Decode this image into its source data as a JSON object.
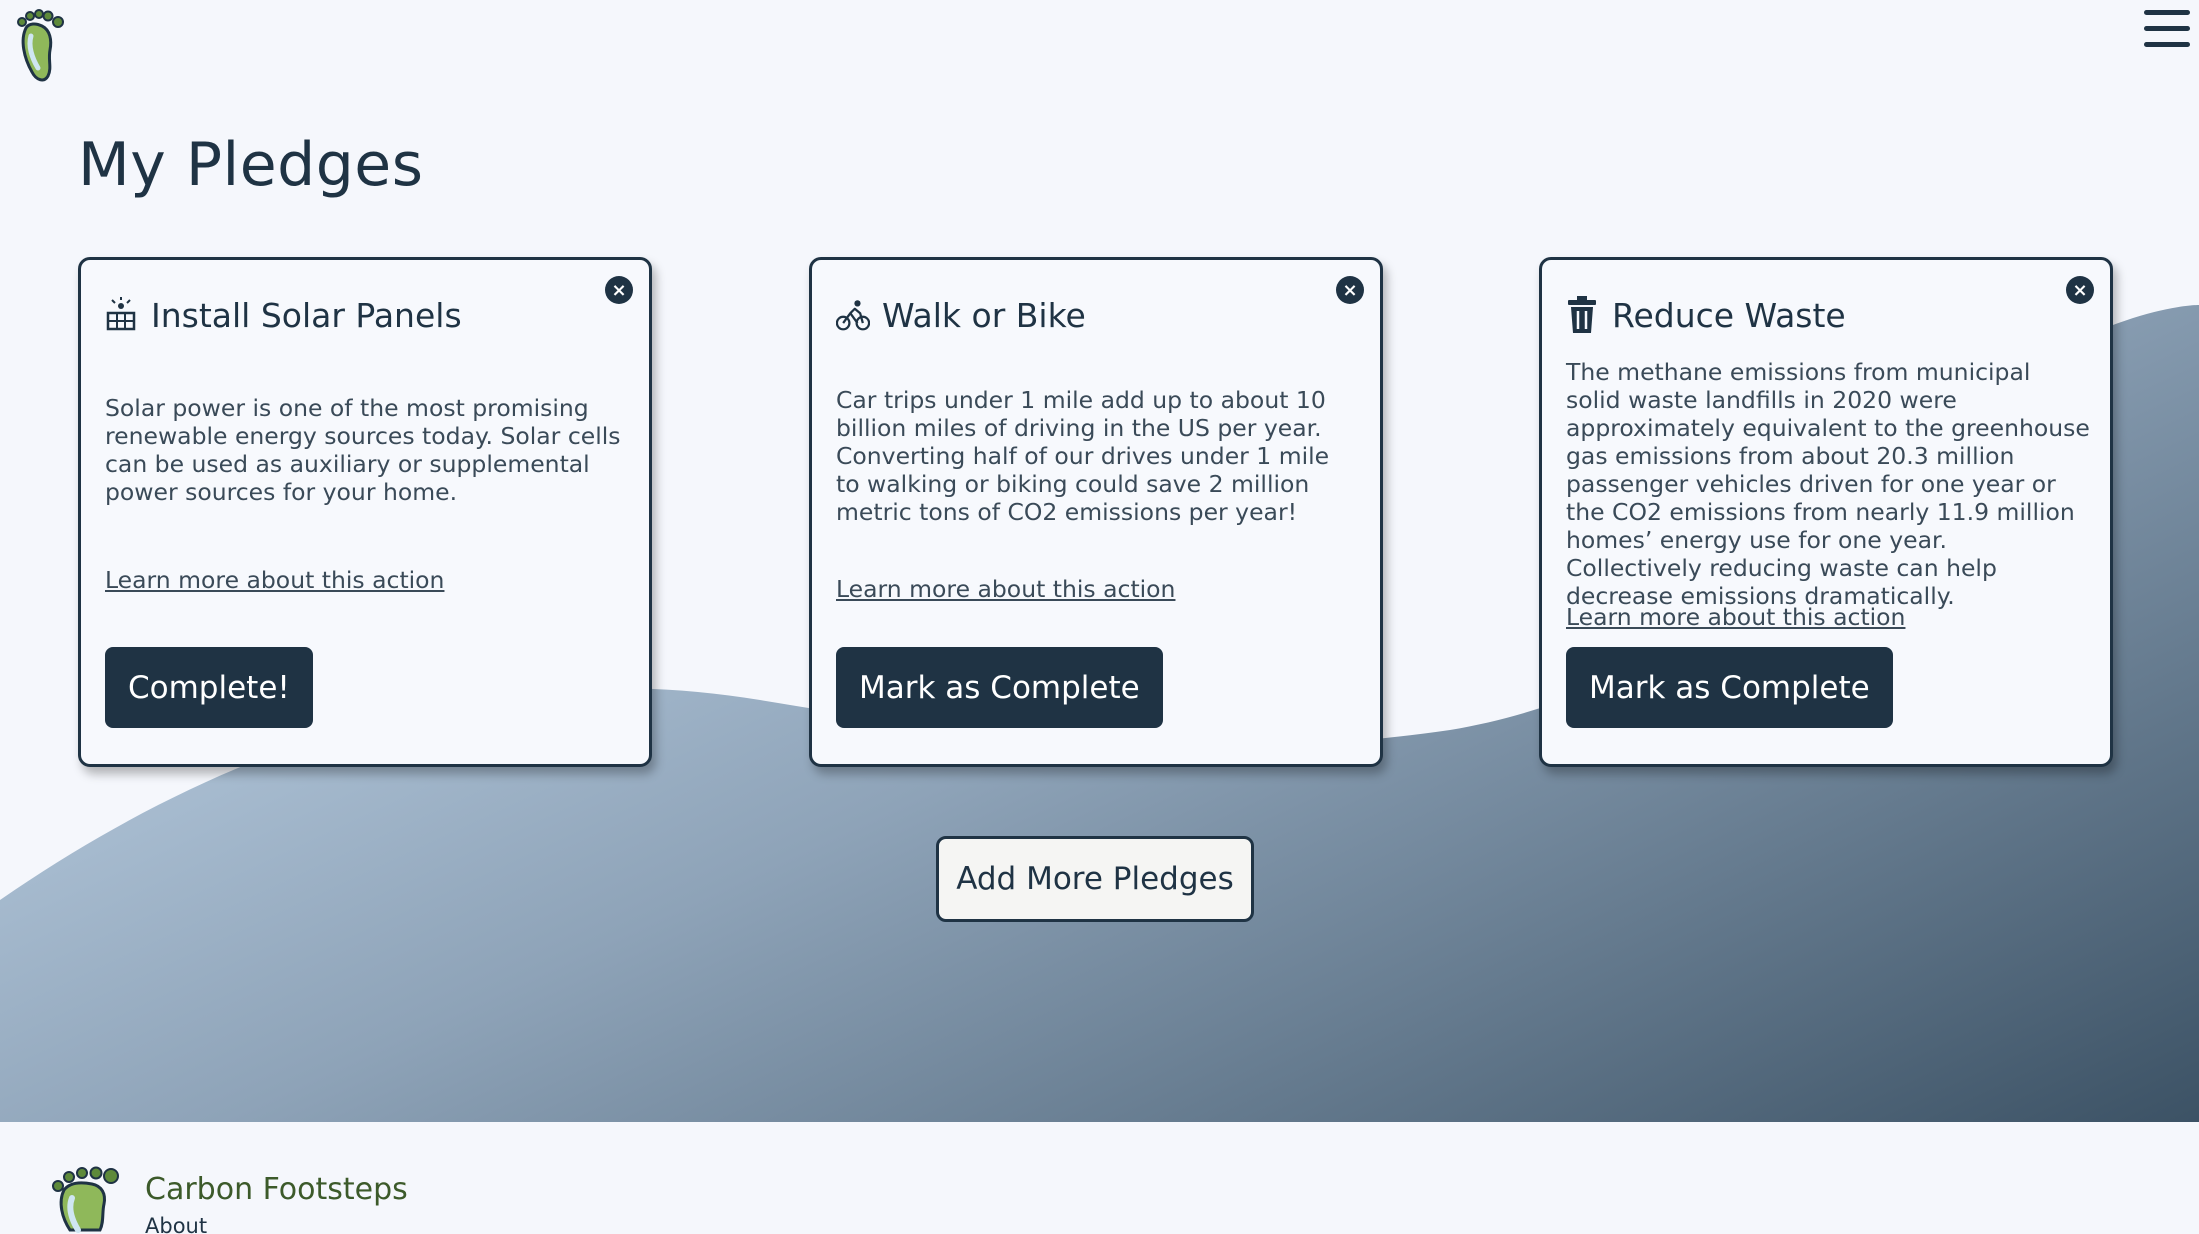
{
  "page": {
    "title": "My Pledges"
  },
  "header": {
    "logo_icon": "footprint-logo-icon",
    "menu_icon": "hamburger-menu-icon"
  },
  "pledges": [
    {
      "icon": "solar-panel-icon",
      "title": "Install Solar Panels",
      "description": "Solar power is one of the most promising renewable energy sources today. Solar cells can be used as auxiliary or supplemental power sources for your home.",
      "link": "Learn more about this action",
      "button": "Complete!",
      "close_icon": "close-icon"
    },
    {
      "icon": "bicycle-icon",
      "title": "Walk or Bike",
      "description": "Car trips under 1 mile add up to about 10 billion miles of driving in the US per year. Converting half of our drives under 1 mile to walking or biking could save 2 million metric tons of CO2 emissions per year!",
      "link": "Learn more about this action",
      "button": "Mark as Complete",
      "close_icon": "close-icon"
    },
    {
      "icon": "trash-icon",
      "title": "Reduce Waste",
      "description": "The methane emissions from municipal solid waste landfills in 2020 were approximately equivalent to the greenhouse gas emissions from about 20.3 million passenger vehicles driven for one year or the CO2 emissions from nearly 11.9 million homes’ energy use for one year. Collectively reducing waste can help decrease emissions dramatically.",
      "link": "Learn more about this action",
      "button": "Mark as Complete",
      "close_icon": "close-icon"
    }
  ],
  "add_button": "Add More Pledges",
  "footer": {
    "brand": "Carbon Footsteps",
    "about": "About"
  },
  "colors": {
    "primary": "#1f3344",
    "background": "#f5f7fc",
    "wave_light": "#b7cde3",
    "wave_dark": "#3e5467",
    "brand_green": "#3c5a2a"
  }
}
